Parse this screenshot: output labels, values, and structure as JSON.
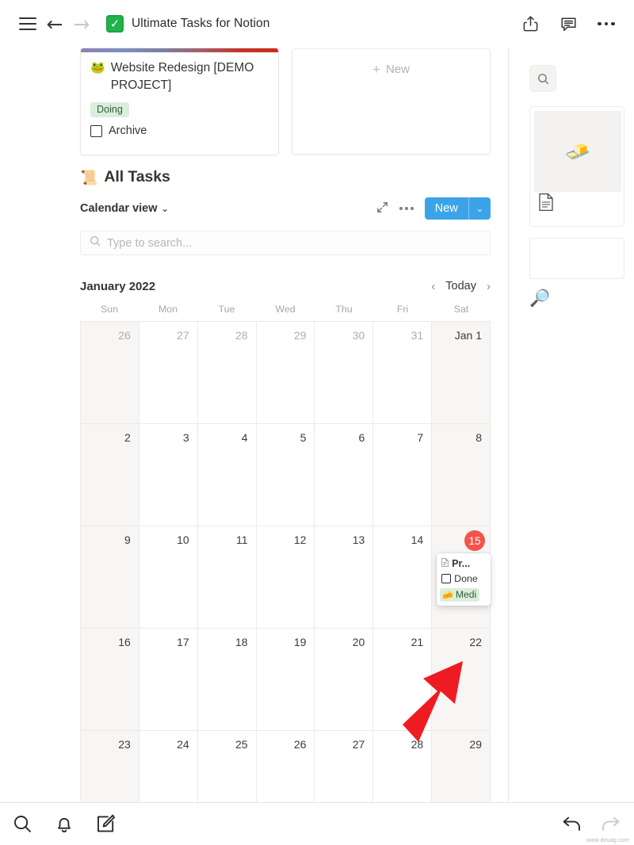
{
  "topbar": {
    "menu_icon": "hamburger-menu-icon",
    "back_icon": "back-arrow-icon",
    "forward_icon": "forward-arrow-icon",
    "favicon_glyph": "✅",
    "title": "Ultimate Tasks for Notion",
    "share_icon": "share-icon",
    "comment_icon": "comment-icon",
    "more_icon": "more-options-icon"
  },
  "cards": {
    "project": {
      "emoji": "🐸",
      "title": "Website Redesign [DEMO PROJECT]",
      "status_badge": "Doing",
      "status_color": "#dbeddb",
      "property_label": "Archive"
    },
    "new_card": {
      "label": "New",
      "plus": "+"
    }
  },
  "database": {
    "emoji": "📜",
    "title": "All Tasks",
    "view_name": "Calendar view",
    "view_caret": "⌄",
    "expand_icon": "expand-icon",
    "more_icon": "view-more-icon",
    "new_button_label": "New",
    "new_button_caret": "⌄",
    "new_button_color": "#3ba4e8"
  },
  "search": {
    "icon": "search-icon",
    "placeholder": "Type to search..."
  },
  "calendar": {
    "month_label": "January 2022",
    "prev_icon": "‹",
    "today_label": "Today",
    "next_icon": "›",
    "weekdays": [
      "Sun",
      "Mon",
      "Tue",
      "Wed",
      "Thu",
      "Fri",
      "Sat"
    ],
    "today_badge_color": "#f2544b",
    "weeks": [
      [
        {
          "label": "26",
          "muted": true,
          "weekend": true
        },
        {
          "label": "27",
          "muted": true,
          "weekend": false
        },
        {
          "label": "28",
          "muted": true,
          "weekend": false
        },
        {
          "label": "29",
          "muted": true,
          "weekend": false
        },
        {
          "label": "30",
          "muted": true,
          "weekend": false
        },
        {
          "label": "31",
          "muted": true,
          "weekend": false
        },
        {
          "label": "Jan 1",
          "muted": false,
          "weekend": true
        }
      ],
      [
        {
          "label": "2",
          "muted": false,
          "weekend": true
        },
        {
          "label": "3",
          "muted": false,
          "weekend": false
        },
        {
          "label": "4",
          "muted": false,
          "weekend": false
        },
        {
          "label": "5",
          "muted": false,
          "weekend": false
        },
        {
          "label": "6",
          "muted": false,
          "weekend": false
        },
        {
          "label": "7",
          "muted": false,
          "weekend": false
        },
        {
          "label": "8",
          "muted": false,
          "weekend": true
        }
      ],
      [
        {
          "label": "9",
          "muted": false,
          "weekend": true
        },
        {
          "label": "10",
          "muted": false,
          "weekend": false
        },
        {
          "label": "11",
          "muted": false,
          "weekend": false
        },
        {
          "label": "12",
          "muted": false,
          "weekend": false
        },
        {
          "label": "13",
          "muted": false,
          "weekend": false
        },
        {
          "label": "14",
          "muted": false,
          "weekend": false
        },
        {
          "label": "15",
          "muted": false,
          "weekend": true,
          "today": true,
          "event": true
        }
      ],
      [
        {
          "label": "16",
          "muted": false,
          "weekend": true
        },
        {
          "label": "17",
          "muted": false,
          "weekend": false
        },
        {
          "label": "18",
          "muted": false,
          "weekend": false
        },
        {
          "label": "19",
          "muted": false,
          "weekend": false
        },
        {
          "label": "20",
          "muted": false,
          "weekend": false
        },
        {
          "label": "21",
          "muted": false,
          "weekend": false
        },
        {
          "label": "22",
          "muted": false,
          "weekend": true
        }
      ],
      [
        {
          "label": "23",
          "muted": false,
          "weekend": true
        },
        {
          "label": "24",
          "muted": false,
          "weekend": false
        },
        {
          "label": "25",
          "muted": false,
          "weekend": false
        },
        {
          "label": "26",
          "muted": false,
          "weekend": false
        },
        {
          "label": "27",
          "muted": false,
          "weekend": false
        },
        {
          "label": "28",
          "muted": false,
          "weekend": false
        },
        {
          "label": "29",
          "muted": false,
          "weekend": true
        }
      ]
    ]
  },
  "event_popup": {
    "doc_icon": "page-icon",
    "title": "Pr...",
    "checkbox_label": "Done",
    "tag_emoji": "🧀",
    "tag_label": "Medi",
    "tag_color": "#dbeddb"
  },
  "annotation": {
    "arrow": "red-arrow-annotation",
    "color": "#ee1c22"
  },
  "right_panel": {
    "search_icon": "search-icon",
    "card_thumb_emoji": "🧈",
    "card_doc_icon": "document-icon",
    "bottom_emoji": "🔎"
  },
  "bottombar": {
    "search_icon": "search-icon",
    "notifications_icon": "bell-icon",
    "compose_icon": "compose-icon",
    "undo_icon": "undo-icon",
    "redo_icon": "redo-icon"
  },
  "watermark": "www.deuag.com"
}
